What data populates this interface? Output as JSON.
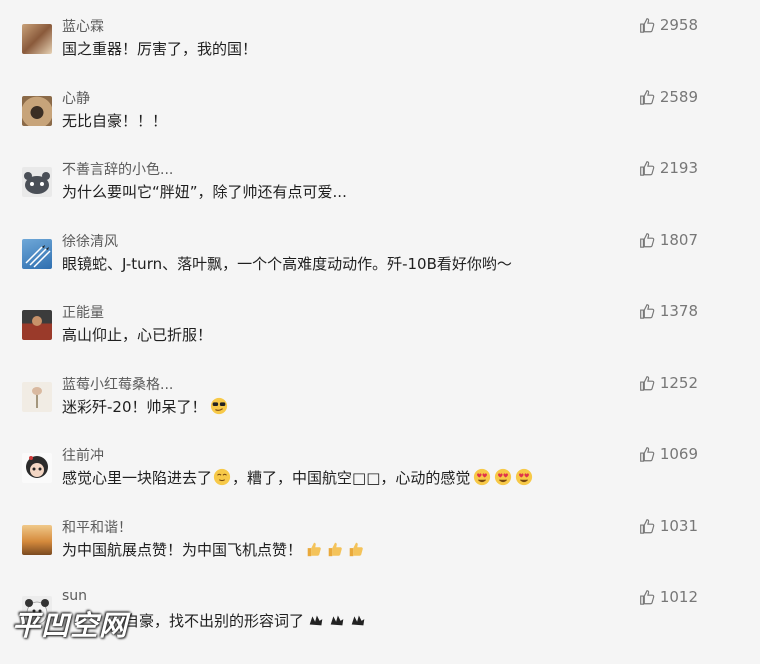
{
  "comments": [
    {
      "name": "蓝心霖",
      "text": "国之重器！厉害了，我的国！",
      "likes": "2958",
      "avatar": "avatar-photo-warm",
      "emoji": []
    },
    {
      "name": "心静",
      "text": "无比自豪！！！",
      "likes": "2589",
      "avatar": "avatar-pug",
      "emoji": []
    },
    {
      "name": "不善言辞的小色...",
      "text": "为什么要叫它“胖妞”，除了帅还有点可爱...",
      "likes": "2193",
      "avatar": "avatar-cartoon-animal",
      "emoji": []
    },
    {
      "name": "徐徐清风",
      "text": "眼镜蛇、J-turn、落叶飘，一个个高难度动动作。歼-10B看好你哟～",
      "likes": "1807",
      "avatar": "avatar-jets",
      "emoji": []
    },
    {
      "name": "正能量",
      "text": "高山仰止，心已折服！",
      "likes": "1378",
      "avatar": "avatar-person",
      "emoji": []
    },
    {
      "name": "蓝莓小红莓桑格...",
      "text": "迷彩歼-20！帅呆了！",
      "likes": "1252",
      "avatar": "avatar-plant",
      "emoji": [
        "sunglasses-emoji"
      ]
    },
    {
      "name": "往前冲",
      "text": "感觉心里一块陷进去了",
      "text2": "，糟了，中国航空□□，心动的感觉",
      "likes": "1069",
      "avatar": "avatar-cartoon-girl",
      "emoji": [
        "heart-eyes-emoji",
        "heart-eyes-emoji",
        "heart-eyes-emoji"
      ]
    },
    {
      "name": "和平和谐！",
      "text": "为中国航展点赞！为中国飞机点赞！",
      "likes": "1031",
      "avatar": "avatar-sunset",
      "emoji": [
        "thumbs-up-emoji",
        "thumbs-up-emoji",
        "thumbs-up-emoji"
      ]
    },
    {
      "name": "sun",
      "text": "自豪，找不出别的形容词了",
      "likes": "1012",
      "avatar": "avatar-dog",
      "emoji": [
        "black-hand-emoji",
        "black-hand-emoji",
        "black-hand-emoji"
      ]
    }
  ],
  "watermark": "平凹空网",
  "colors": {
    "background": "#f5f5f5",
    "name": "#5b5b5b",
    "text": "#1f1f1f",
    "likes": "#777777"
  }
}
